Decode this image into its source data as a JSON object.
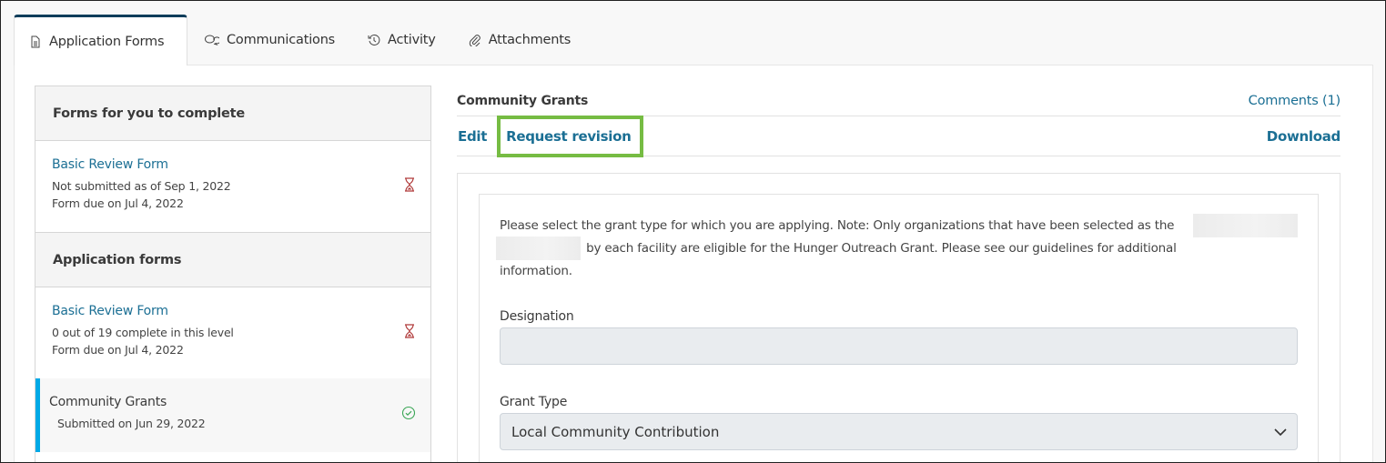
{
  "tabs": [
    {
      "label": "Application Forms",
      "icon": "document-icon",
      "active": true
    },
    {
      "label": "Communications",
      "icon": "chat-bubbles-icon",
      "active": false
    },
    {
      "label": "Activity",
      "icon": "history-icon",
      "active": false
    },
    {
      "label": "Attachments",
      "icon": "paperclip-icon",
      "active": false
    }
  ],
  "sidebar": {
    "sections": [
      {
        "header": "Forms for you to complete",
        "items": [
          {
            "title": "Basic Review Form",
            "lines": [
              "Not submitted as of Sep 1, 2022",
              "Form due on Jul 4, 2022"
            ],
            "status": "pending",
            "status_icon": "hourglass-icon"
          }
        ]
      },
      {
        "header": "Application forms",
        "items": [
          {
            "title": "Basic Review Form",
            "lines": [
              "0 out of 19 complete in this level",
              "Form due on Jul 4, 2022"
            ],
            "status": "pending",
            "status_icon": "hourglass-icon"
          },
          {
            "title": "Community Grants",
            "lines": [
              "Submitted on Jun 29, 2022"
            ],
            "status": "submitted",
            "status_icon": "check-circle-icon",
            "selected": true
          }
        ]
      }
    ]
  },
  "main": {
    "title": "Community Grants",
    "comments_label": "Comments (1)",
    "actions": {
      "edit": "Edit",
      "request_revision": "Request revision",
      "download": "Download"
    },
    "form": {
      "instructions_part1": "Please select the grant type for which you are applying. Note: Only organizations that have been selected as the",
      "instructions_part2": "by each facility are eligible for the Hunger Outreach Grant. Please see our guidelines for additional information.",
      "fields": [
        {
          "label": "Designation",
          "value": ""
        },
        {
          "label": "Grant Type",
          "value": "Local Community Contribution"
        }
      ]
    }
  },
  "colors": {
    "link": "#1b6f94",
    "active_tab_border": "#0e3d5a",
    "selected_item_accent": "#00a9e6",
    "highlight_box": "#76bc43",
    "pending_icon": "#b03a3a",
    "submitted_icon": "#3aa655"
  }
}
